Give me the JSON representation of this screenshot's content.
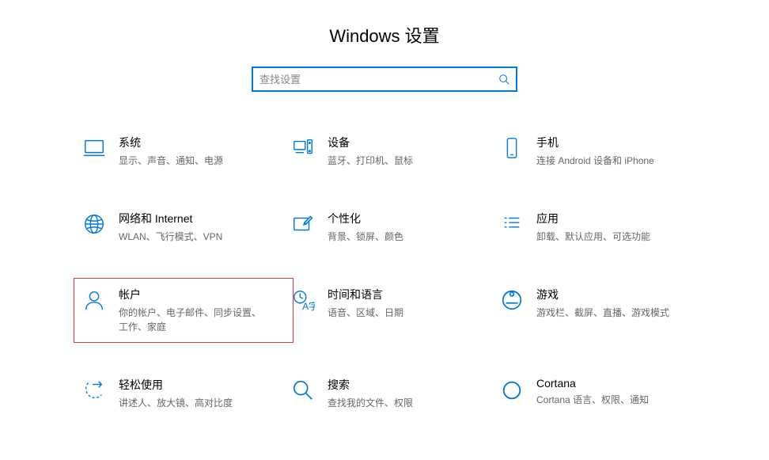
{
  "title": "Windows 设置",
  "search": {
    "placeholder": "查找设置"
  },
  "tiles": [
    {
      "title": "系统",
      "desc": "显示、声音、通知、电源"
    },
    {
      "title": "设备",
      "desc": "蓝牙、打印机、鼠标"
    },
    {
      "title": "手机",
      "desc": "连接 Android 设备和 iPhone"
    },
    {
      "title": "网络和 Internet",
      "desc": "WLAN、飞行模式、VPN"
    },
    {
      "title": "个性化",
      "desc": "背景、锁屏、颜色"
    },
    {
      "title": "应用",
      "desc": "卸载、默认应用、可选功能"
    },
    {
      "title": "帐户",
      "desc": "你的帐户、电子邮件、同步设置、工作、家庭"
    },
    {
      "title": "时间和语言",
      "desc": "语音、区域、日期"
    },
    {
      "title": "游戏",
      "desc": "游戏栏、截屏、直播、游戏模式"
    },
    {
      "title": "轻松使用",
      "desc": "讲述人、放大镜、高对比度"
    },
    {
      "title": "搜索",
      "desc": "查找我的文件、权限"
    },
    {
      "title": "Cortana",
      "desc": "Cortana 语言、权限、通知"
    }
  ]
}
